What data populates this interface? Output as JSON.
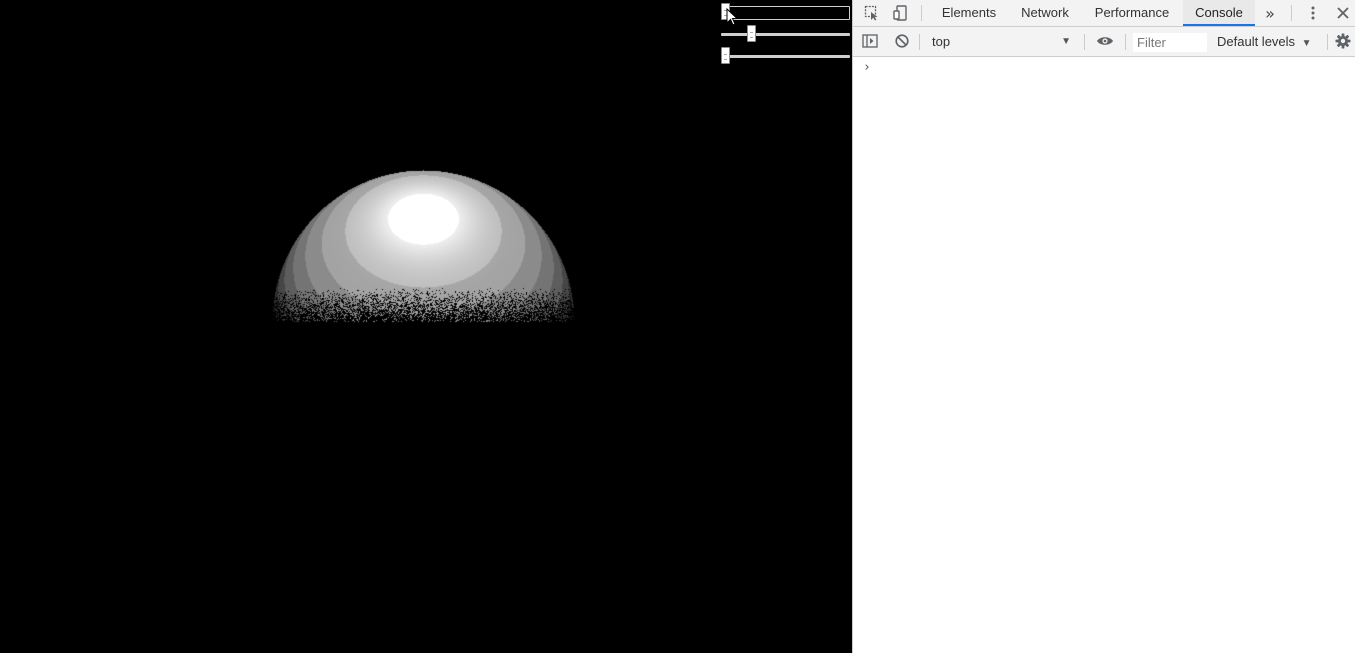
{
  "viewport": {
    "sliders": [
      {
        "name": "slider-1",
        "value_fraction": 0.0
      },
      {
        "name": "slider-2",
        "value_fraction": 0.22
      },
      {
        "name": "slider-3",
        "value_fraction": 0.0
      }
    ]
  },
  "devtools": {
    "tabs": [
      "Elements",
      "Network",
      "Performance",
      "Console"
    ],
    "active_tab": "Console",
    "more_tabs_label": "»",
    "icons": {
      "inspect": "inspect-element-icon",
      "device": "device-toolbar-icon",
      "more": "more-tabs-icon",
      "menu": "kebab-menu-icon",
      "close": "close-icon",
      "sidebar": "show-sidebar-icon",
      "clear": "clear-console-icon",
      "eye": "live-expression-icon",
      "settings": "gear-icon"
    },
    "console": {
      "context": "top",
      "filter_placeholder": "Filter",
      "levels_label": "Default levels",
      "prompt": "›"
    }
  },
  "colors": {
    "accent": "#1a73e8",
    "page_background": "#000000",
    "panel_background": "#f3f3f3"
  }
}
